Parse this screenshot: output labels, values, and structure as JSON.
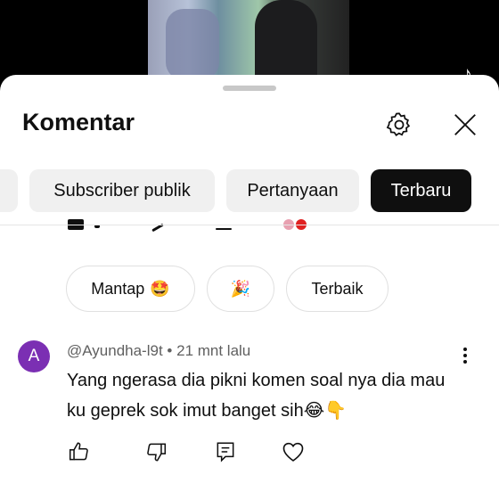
{
  "header": {
    "title": "Komentar",
    "settings_icon": "gear-icon",
    "close_icon": "close-icon"
  },
  "filters": {
    "chips": [
      {
        "label": "Subscriber publik",
        "active": false
      },
      {
        "label": "Pertanyaan",
        "active": false
      },
      {
        "label": "Terbaru",
        "active": true
      }
    ],
    "active_color": "#0f0f0f"
  },
  "reactions": [
    {
      "label": "Mantap",
      "emoji": "🤩"
    },
    {
      "label": "",
      "emoji": "🎉"
    },
    {
      "label": "Terbaik",
      "emoji": ""
    }
  ],
  "comment": {
    "avatar_letter": "A",
    "avatar_color": "#7b2fb3",
    "author": "@Ayundha-l9t",
    "time": "21 mnt lalu",
    "text": "Yang ngerasa dia pikni komen soal nya dia mau ku geprek sok imut banget sih😂👇",
    "actions": [
      "like-icon",
      "dislike-icon",
      "reply-icon",
      "heart-icon"
    ]
  }
}
